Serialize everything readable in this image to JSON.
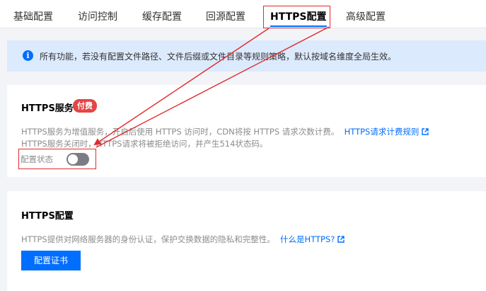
{
  "tabs": [
    {
      "label": "基础配置"
    },
    {
      "label": "访问控制"
    },
    {
      "label": "缓存配置"
    },
    {
      "label": "回源配置"
    },
    {
      "label": "HTTPS配置"
    },
    {
      "label": "高级配置"
    }
  ],
  "active_tab": "HTTPS配置",
  "notice": {
    "icon": "info-icon",
    "text": "所有功能，若没有配置文件路径、文件后缀或文件目录等规则策略，默认按域名维度全局生效。"
  },
  "https_service": {
    "title": "HTTPS服务",
    "badge": "付费",
    "desc_line1": "HTTPS服务为增值服务，开启后使用 HTTPS 访问时，CDN将按 HTTPS 请求次数计费。",
    "billing_link": "HTTPS请求计费规则",
    "desc_line2": "HTTPS服务关闭时，HTTPS请求将被拒绝访问，并产生514状态码。",
    "status_label": "配置状态",
    "toggle_on": false
  },
  "https_config": {
    "title": "HTTPS配置",
    "desc": "HTTPS提供对网络服务器的身份认证，保护交换数据的隐私和完整性。",
    "what_link": "什么是HTTPS?",
    "button": "配置证书"
  },
  "colors": {
    "accent": "#006eff",
    "badge": "#e54545",
    "annotation": "#e02b2b",
    "notice_bg": "#dceafd"
  }
}
